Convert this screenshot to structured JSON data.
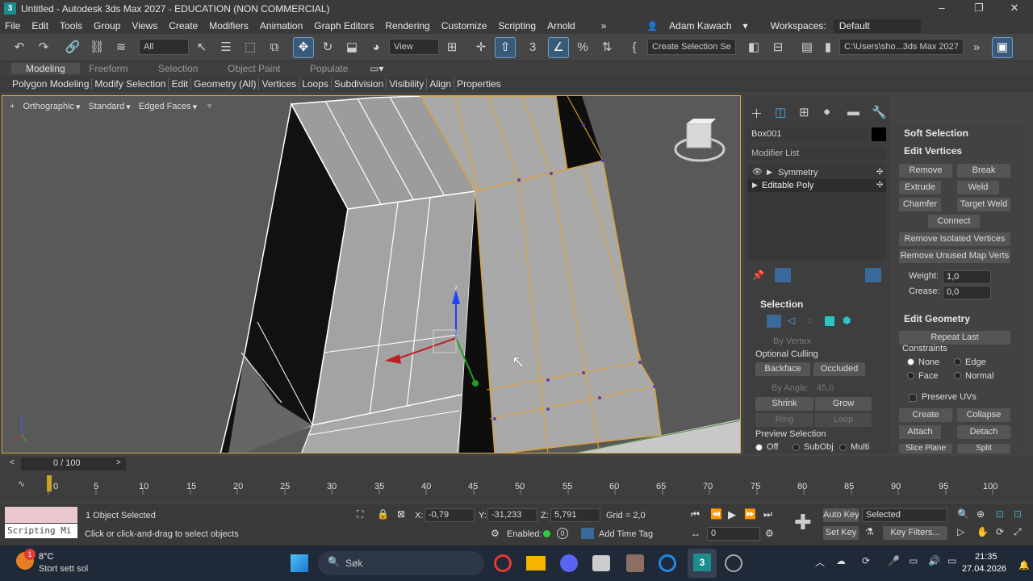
{
  "window": {
    "title": "Untitled - Autodesk 3ds Max 2027 - EDUCATION (NON COMMERCIAL)"
  },
  "menu": [
    "File",
    "Edit",
    "Tools",
    "Group",
    "Views",
    "Create",
    "Modifiers",
    "Animation",
    "Graph Editors",
    "Rendering",
    "Customize",
    "Scripting",
    "Arnold"
  ],
  "account": {
    "user": "Adam Kawach",
    "workspaces_label": "Workspaces:",
    "workspace": "Default"
  },
  "toolbar": {
    "filter": "All",
    "ref_coord": "View",
    "selection_set": "Create Selection Se",
    "project_path": "C:\\Users\\sho...3ds Max 2027"
  },
  "ribbon": {
    "tabs": [
      "Modeling",
      "Freeform",
      "Selection",
      "Object Paint",
      "Populate"
    ],
    "panels": [
      "Polygon Modeling",
      "Modify Selection",
      "Edit",
      "Geometry (All)",
      "Vertices",
      "Loops",
      "Subdivision",
      "Visibility",
      "Align",
      "Properties"
    ]
  },
  "viewport": {
    "labels": [
      "+",
      "Orthographic",
      "Standard",
      "Edged Faces"
    ]
  },
  "command_panel": {
    "object_name": "Box001",
    "modifier_list": "Modifier List",
    "stack": [
      "Symmetry",
      "Editable Poly"
    ],
    "selection": {
      "title": "Selection",
      "by_vertex": "By Vertex",
      "optional_culling": "Optional Culling",
      "backface": "Backface",
      "occluded": "Occluded",
      "by_angle_label": "By Angle:",
      "by_angle_value": "45,0",
      "shrink": "Shrink",
      "grow": "Grow",
      "ring": "Ring",
      "loop": "Loop",
      "preview": "Preview Selection",
      "off": "Off",
      "subobj": "SubObj",
      "multi": "Multi"
    }
  },
  "rollout": {
    "soft_selection": "Soft Selection",
    "edit_vertices": "Edit Vertices",
    "remove": "Remove",
    "break": "Break",
    "extrude": "Extrude",
    "weld": "Weld",
    "chamfer": "Chamfer",
    "target_weld": "Target Weld",
    "connect": "Connect",
    "remove_isolated": "Remove Isolated Vertices",
    "remove_unused": "Remove Unused Map Verts",
    "weight_label": "Weight:",
    "weight": "1,0",
    "crease_label": "Crease:",
    "crease": "0,0",
    "edit_geometry": "Edit Geometry",
    "repeat_last": "Repeat Last",
    "constraints": "Constraints",
    "none": "None",
    "edge": "Edge",
    "face": "Face",
    "normal": "Normal",
    "preserve_uvs": "Preserve UVs",
    "create": "Create",
    "collapse": "Collapse",
    "attach": "Attach",
    "detach": "Detach",
    "slice_plane": "Slice Plane",
    "split": "Split"
  },
  "timeline": {
    "frame": "0 / 100",
    "ticks": [
      "0",
      "5",
      "10",
      "15",
      "20",
      "25",
      "30",
      "35",
      "40",
      "45",
      "50",
      "55",
      "60",
      "65",
      "70",
      "75",
      "80",
      "85",
      "90",
      "95",
      "100"
    ]
  },
  "status": {
    "selected": "1 Object Selected",
    "prompt": "Click or click-and-drag to select objects",
    "script_label": "Scripting Mi",
    "x_label": "X:",
    "x": "-0,79",
    "y_label": "Y:",
    "y": "-31,233",
    "z_label": "Z:",
    "z": "5,791",
    "grid": "Grid = 2,0",
    "enabled": "Enabled:",
    "add_time_tag": "Add Time Tag",
    "auto_key": "Auto Key",
    "selected_dropdown": "Selected",
    "set_key": "Set Key",
    "key_filters": "Key Filters...",
    "frame_field": "0"
  },
  "taskbar": {
    "weather_temp": "8°C",
    "weather_text": "Stort sett sol",
    "badge": "1",
    "search": "Søk",
    "time": "21:35",
    "date": "27.04.2026"
  }
}
